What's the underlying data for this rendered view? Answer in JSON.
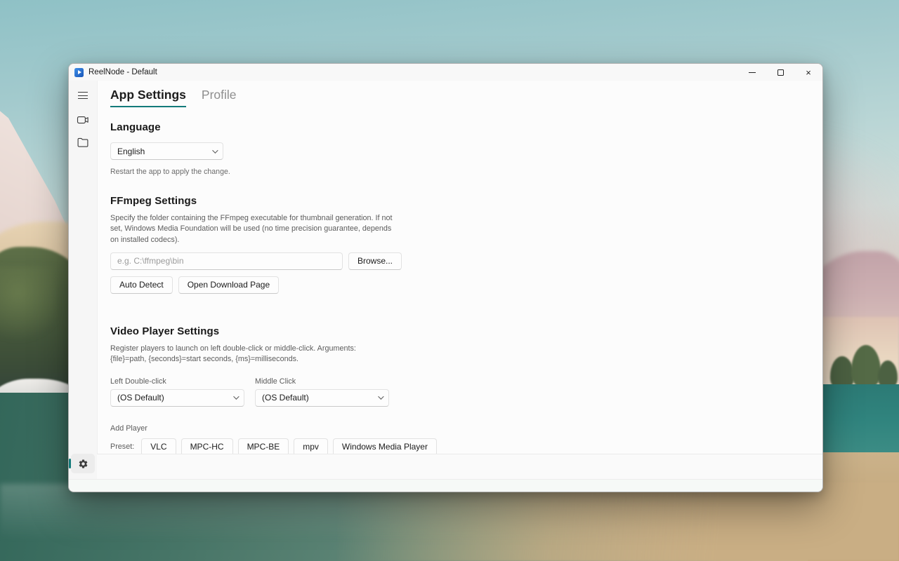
{
  "window": {
    "title": "ReelNode - Default"
  },
  "tabs": {
    "app_settings": "App Settings",
    "profile": "Profile"
  },
  "language": {
    "heading": "Language",
    "value": "English",
    "hint": "Restart the app to apply the change."
  },
  "ffmpeg": {
    "heading": "FFmpeg Settings",
    "description": "Specify the folder containing the FFmpeg executable for thumbnail generation. If not set, Windows Media Foundation will be used (no time precision guarantee, depends on installed codecs).",
    "placeholder": "e.g. C:\\ffmpeg\\bin",
    "browse": "Browse...",
    "auto_detect": "Auto Detect",
    "open_download": "Open Download Page"
  },
  "player": {
    "heading": "Video Player Settings",
    "description": "Register players to launch on left double-click or middle-click. Arguments: {file}=path, {seconds}=start seconds, {ms}=milliseconds.",
    "left_label": "Left Double-click",
    "left_value": "(OS Default)",
    "middle_label": "Middle Click",
    "middle_value": "(OS Default)",
    "add_label": "Add Player",
    "preset_label": "Preset:",
    "presets": [
      "VLC",
      "MPC-HC",
      "MPC-BE",
      "mpv",
      "Windows Media Player"
    ]
  },
  "colors": {
    "accent": "#137a7a"
  }
}
